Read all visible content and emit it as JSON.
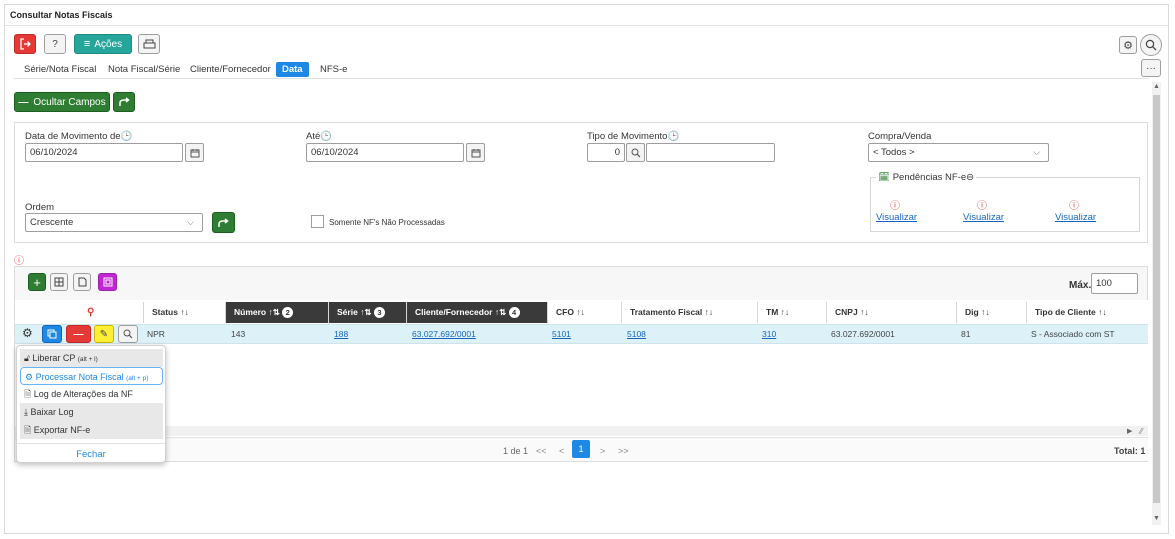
{
  "window": {
    "title": "Consultar Notas Fiscais"
  },
  "toolbar": {
    "help_label": "?",
    "acoes_label": "Ações"
  },
  "tabs": [
    {
      "label": "Série/Nota Fiscal"
    },
    {
      "label": "Nota Fiscal/Série"
    },
    {
      "label": "Cliente/Fornecedor"
    },
    {
      "label": "Data"
    },
    {
      "label": "NFS-e"
    }
  ],
  "buttons": {
    "ocultar_campos": "Ocultar Campos"
  },
  "form": {
    "data_movimento_label": "Data de Movimento de",
    "data_movimento_value": "06/10/2024",
    "ate_label": "Até",
    "ate_value": "06/10/2024",
    "tipo_movimento_label": "Tipo de Movimento",
    "tipo_movimento_value": "0",
    "compra_venda_label": "Compra/Venda",
    "compra_venda_value": "< Todos >",
    "ordem_label": "Ordem",
    "ordem_value": "Crescente",
    "somente_label": "Somente NF's Não Processadas"
  },
  "pendencias": {
    "title": "Pendências NF-e",
    "items": [
      {
        "label": "Visualizar"
      },
      {
        "label": "Visualizar"
      },
      {
        "label": "Visualizar"
      }
    ]
  },
  "grid": {
    "max_label": "Máx.",
    "max_value": "100",
    "columns": [
      {
        "label": "Status",
        "sort": "↑↓"
      },
      {
        "label": "Número",
        "sort": "↑⇅",
        "order": "2"
      },
      {
        "label": "Série",
        "sort": "↑⇅",
        "order": "3"
      },
      {
        "label": "Cliente/Fornecedor",
        "sort": "↑⇅",
        "order": "4"
      },
      {
        "label": "CFO",
        "sort": "↑↓"
      },
      {
        "label": "Tratamento Fiscal",
        "sort": "↑↓"
      },
      {
        "label": "TM",
        "sort": "↑↓"
      },
      {
        "label": "CNPJ",
        "sort": "↑↓"
      },
      {
        "label": "Dig",
        "sort": "↑↓"
      },
      {
        "label": "Tipo de Cliente",
        "sort": "↑↓"
      }
    ],
    "row": {
      "status": "NPR",
      "numero": "143",
      "serie": "188",
      "cliente": "63.027.692/0001",
      "cfo": "5101",
      "tratamento": "5108",
      "tm": "310",
      "cnpj": "63.027.692/0001",
      "dig": "81",
      "tipo_cliente": "S - Associado com ST"
    },
    "pager": {
      "info": "1 de 1",
      "first": "<<",
      "prev": "<",
      "page": "1",
      "next": ">",
      "last": ">>",
      "total": "Total: 1"
    }
  },
  "popup": {
    "items": [
      {
        "label": "Liberar CP",
        "shortcut": "(alt + l)"
      },
      {
        "label": "Processar Nota Fiscal",
        "shortcut": "(alt + p)"
      },
      {
        "label": "Log de Alterações da NF"
      },
      {
        "label": "Baixar Log"
      },
      {
        "label": "Exportar NF-e"
      }
    ],
    "close_label": "Fechar"
  },
  "colors": {
    "accent": "#1e88e5",
    "green": "#2e7d32",
    "red": "#e53935",
    "teal": "#26a69a",
    "purple": "#c026d3",
    "yellow": "#ffee33",
    "row_highlight": "#ddf2f8"
  }
}
